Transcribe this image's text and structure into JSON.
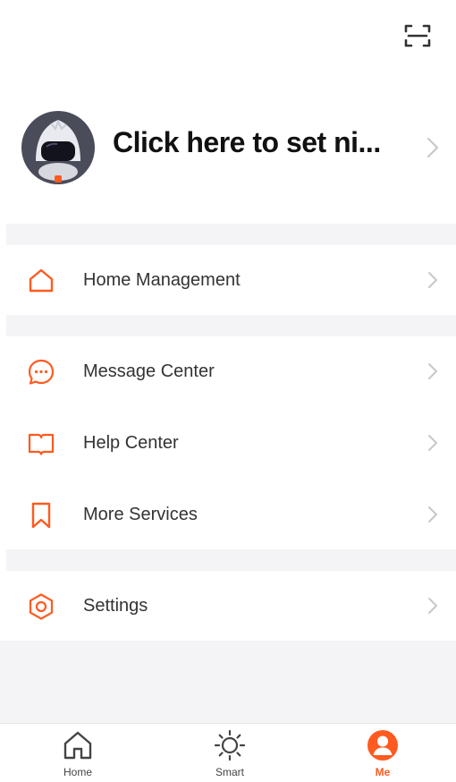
{
  "profile": {
    "name": "Click here to set ni..."
  },
  "menu": {
    "home_management": "Home Management",
    "message_center": "Message Center",
    "help_center": "Help Center",
    "more_services": "More Services",
    "settings": "Settings"
  },
  "tabs": [
    {
      "label": "Home"
    },
    {
      "label": "Smart"
    },
    {
      "label": "Me"
    }
  ],
  "icons": {
    "scan": "scan-icon",
    "home": "home-icon",
    "message": "chat-bubble-icon",
    "help": "book-icon",
    "services": "bookmark-icon",
    "settings": "hexagon-gear-icon",
    "smart": "sun-icon",
    "me": "user-icon"
  },
  "colors": {
    "accent": "#ff5a1f",
    "text": "#333333",
    "divider": "#f4f4f6"
  }
}
